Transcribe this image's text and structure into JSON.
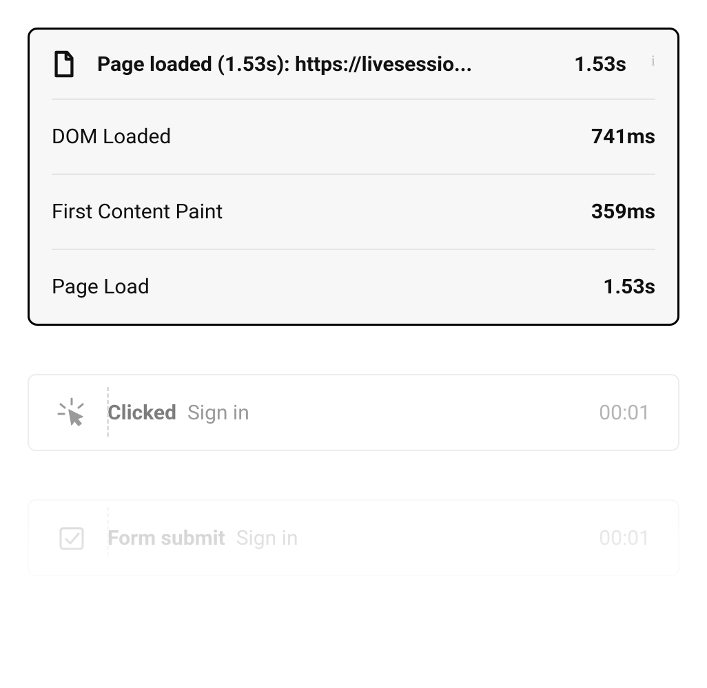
{
  "main_card": {
    "title": "Page loaded (1.53s): https://livesessio...",
    "duration": "1.53s",
    "info_icon": "i",
    "metrics": [
      {
        "label": "DOM Loaded",
        "value": "741ms"
      },
      {
        "label": "First Content Paint",
        "value": "359ms"
      },
      {
        "label": "Page Load",
        "value": "1.53s"
      }
    ]
  },
  "events": [
    {
      "action": "Clicked",
      "target": "Sign in",
      "time": "00:01"
    },
    {
      "action": "Form submit",
      "target": "Sign in",
      "time": "00:01"
    }
  ]
}
